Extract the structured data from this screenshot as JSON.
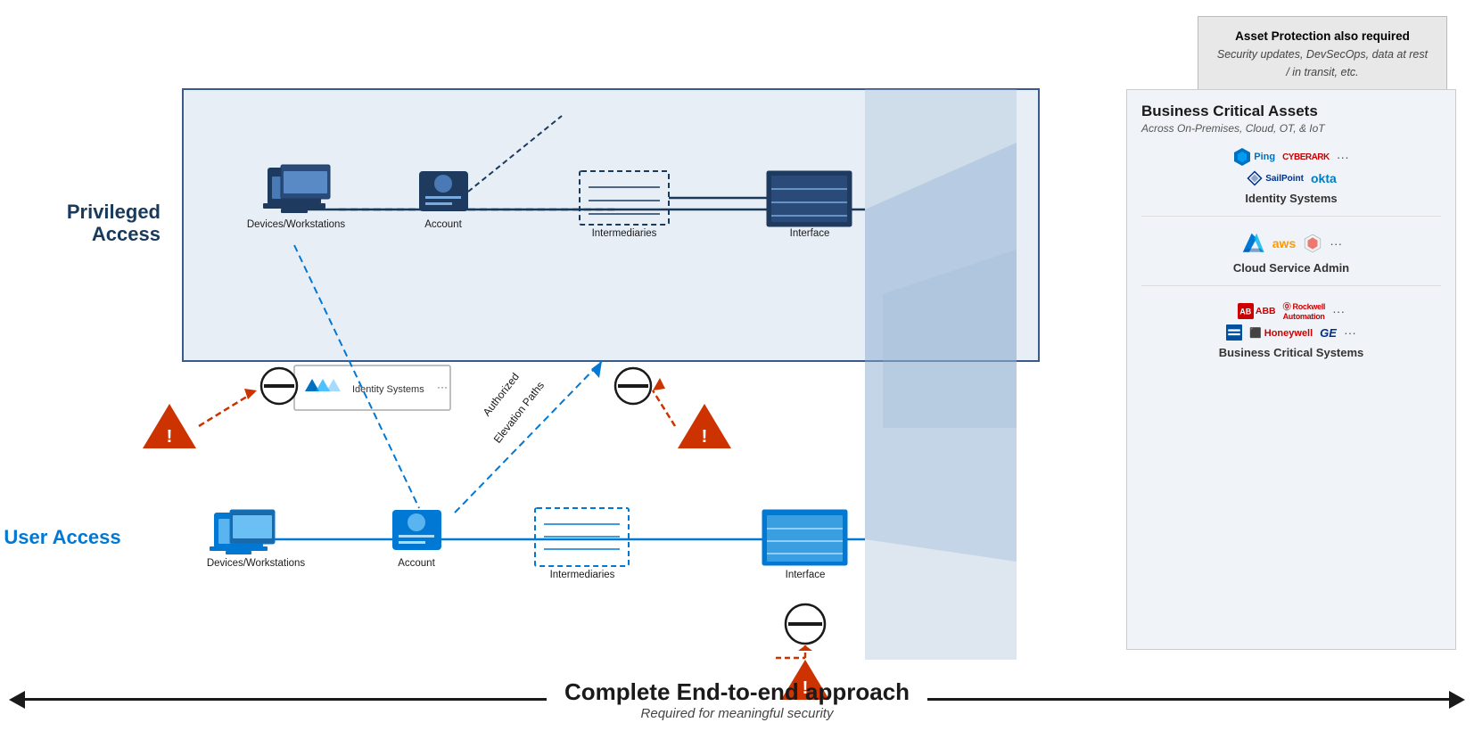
{
  "callout": {
    "title": "Asset Protection also required",
    "subtitle": "Security updates, DevSecOps, data at rest / in transit, etc."
  },
  "privileged_label": "Privileged Access",
  "user_label": "User Access",
  "bca": {
    "title": "Business Critical Assets",
    "subtitle": "Across On-Premises, Cloud, OT, & IoT",
    "sections": [
      {
        "id": "identity",
        "label": "Identity Systems",
        "logos": [
          "Ping",
          "CYBERARK",
          "SailPoint",
          "okta",
          "..."
        ]
      },
      {
        "id": "cloud",
        "label": "Cloud Service Admin",
        "logos": [
          "Azure",
          "aws",
          "GCP",
          "..."
        ]
      },
      {
        "id": "bcs",
        "label": "Business Critical Systems",
        "logos": [
          "ABB",
          "Rockwell Automation",
          "Honeywell",
          "GE",
          "..."
        ]
      }
    ]
  },
  "nodes": {
    "priv_devices": "Devices/Workstations",
    "priv_account": "Account",
    "priv_intermediaries": "Intermediaries",
    "priv_interface": "Interface",
    "user_devices": "Devices/Workstations",
    "user_account": "Account",
    "user_intermediaries": "Intermediaries",
    "user_interface": "Interface"
  },
  "identity_popup": {
    "label": "Identity Systems"
  },
  "elevation_label": "Authorized\nElevation Paths",
  "bottom": {
    "title": "Complete End-to-end approach",
    "subtitle": "Required for meaningful security"
  }
}
